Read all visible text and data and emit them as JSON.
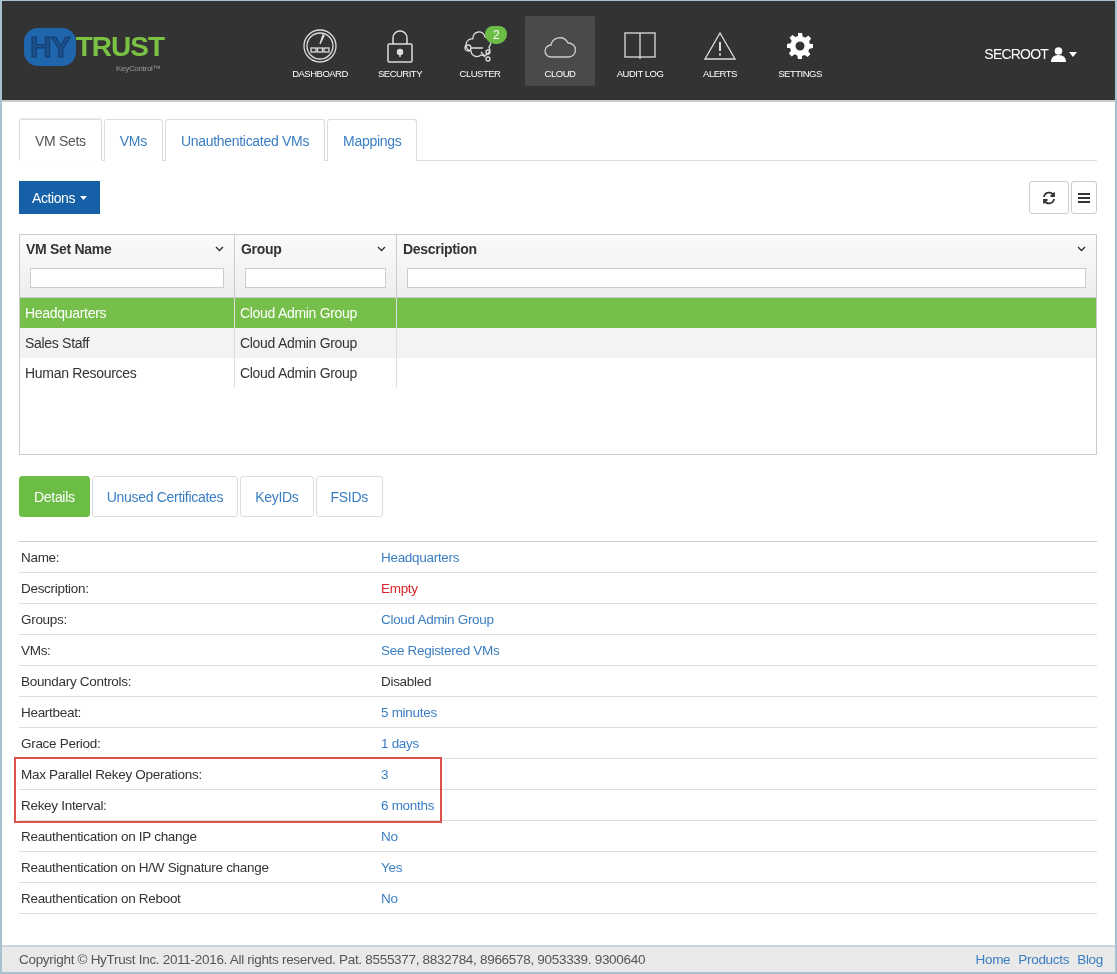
{
  "header": {
    "logo": {
      "brand_left": "HY",
      "brand_right": "TRUST",
      "product": "KeyControl™"
    },
    "nav": [
      {
        "label": "DASHBOARD",
        "kind": "dashboard",
        "selected": false
      },
      {
        "label": "SECURITY",
        "kind": "lock",
        "selected": false
      },
      {
        "label": "CLUSTER",
        "kind": "cluster",
        "selected": false,
        "badge": "2"
      },
      {
        "label": "CLOUD",
        "kind": "cloud",
        "selected": true
      },
      {
        "label": "AUDIT LOG",
        "kind": "book",
        "selected": false
      },
      {
        "label": "ALERTS",
        "kind": "alert",
        "selected": false
      },
      {
        "label": "SETTINGS",
        "kind": "gear",
        "selected": false
      }
    ],
    "user": "SECROOT"
  },
  "tabs": [
    {
      "label": "VM Sets",
      "selected": true
    },
    {
      "label": "VMs",
      "selected": false
    },
    {
      "label": "Unauthenticated VMs",
      "selected": false
    },
    {
      "label": "Mappings",
      "selected": false
    }
  ],
  "actions_button": "Actions",
  "table": {
    "columns": [
      "VM Set Name",
      "Group",
      "Description"
    ],
    "rows": [
      {
        "cells": [
          "Headquarters",
          "Cloud Admin Group",
          ""
        ],
        "selected": true
      },
      {
        "cells": [
          "Sales Staff",
          "Cloud Admin Group",
          ""
        ],
        "selected": false
      },
      {
        "cells": [
          "Human Resources",
          "Cloud Admin Group",
          ""
        ],
        "selected": false
      }
    ]
  },
  "detail_tabs": [
    {
      "label": "Details",
      "selected": true
    },
    {
      "label": "Unused Certificates",
      "selected": false
    },
    {
      "label": "KeyIDs",
      "selected": false
    },
    {
      "label": "FSIDs",
      "selected": false
    }
  ],
  "details": [
    {
      "highlighted": false,
      "rows": [
        {
          "label": "Name:",
          "value": "Headquarters",
          "kind": "link"
        },
        {
          "label": "Description:",
          "value": "Empty",
          "kind": "empty"
        },
        {
          "label": "Groups:",
          "value": "Cloud Admin Group",
          "kind": "link"
        },
        {
          "label": "VMs:",
          "value": "See Registered VMs",
          "kind": "link"
        },
        {
          "label": "Boundary Controls:",
          "value": "Disabled",
          "kind": "plain"
        },
        {
          "label": "Heartbeat:",
          "value": "5 minutes",
          "kind": "link"
        },
        {
          "label": "Grace Period:",
          "value": "1 days",
          "kind": "link"
        }
      ]
    },
    {
      "highlighted": true,
      "rows": [
        {
          "label": "Max Parallel Rekey Operations:",
          "value": "3",
          "kind": "link"
        },
        {
          "label": "Rekey Interval:",
          "value": "6 months",
          "kind": "link"
        }
      ]
    },
    {
      "highlighted": false,
      "rows": [
        {
          "label": "Reauthentication on IP change",
          "value": "No",
          "kind": "link"
        },
        {
          "label": "Reauthentication on H/W Signature change",
          "value": "Yes",
          "kind": "link"
        },
        {
          "label": "Reauthentication on Reboot",
          "value": "No",
          "kind": "link"
        }
      ]
    }
  ],
  "footer": {
    "copyright": "Copyright © HyTrust Inc. 2011-2016. All rights reserved. Pat. 8555377, 8832784, 8966578, 9053339. 9300640",
    "links": [
      "Home",
      "Products",
      "Blog"
    ]
  }
}
